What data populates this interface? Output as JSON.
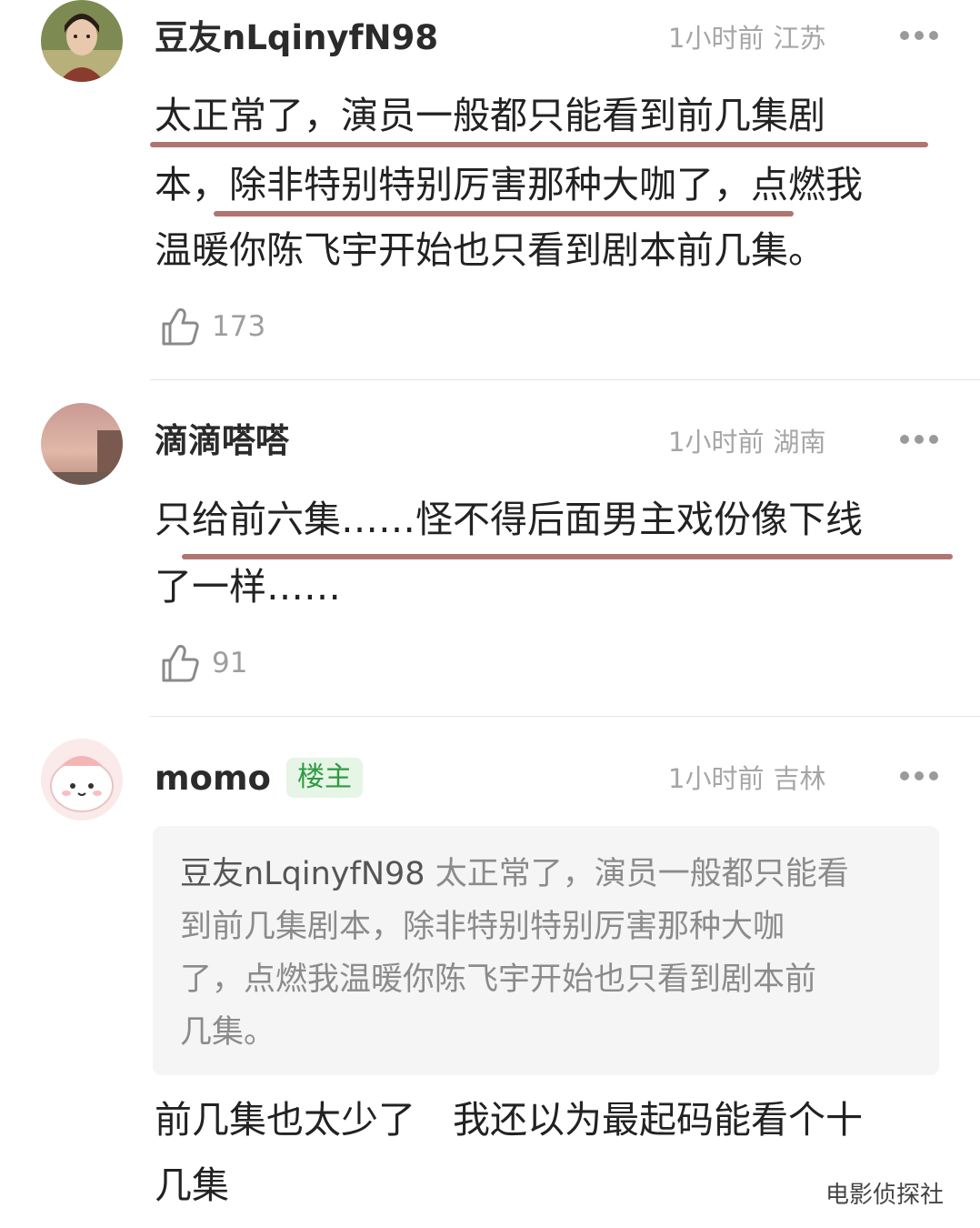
{
  "comments": [
    {
      "username": "豆友nLqinyfN98",
      "time": "1小时前",
      "location": "江苏",
      "lines": [
        "太正常了，演员一般都只能看到前几集剧",
        "本，除非特别特别厉害那种大咖了，点燃我",
        "温暖你陈飞宇开始也只看到剧本前几集。"
      ],
      "likes": "173",
      "avatar_icon": "portrait-avatar-icon"
    },
    {
      "username": "滴滴嗒嗒",
      "time": "1小时前",
      "location": "湖南",
      "lines": [
        "只给前六集……怪不得后面男主戏份像下线",
        "了一样……"
      ],
      "likes": "91",
      "avatar_icon": "sunset-avatar-icon"
    },
    {
      "username": "momo",
      "badge": "楼主",
      "time": "1小时前",
      "location": "吉林",
      "quote": {
        "author": "豆友nLqinyfN98",
        "line1": "太正常了，演员一般都只能看",
        "line2": "到前几集剧本，除非特别特别厉害那种大咖",
        "line3": "了，点燃我温暖你陈飞宇开始也只看到剧本前",
        "line4": "几集。"
      },
      "lines": [
        "前几集也太少了　我还以为最起码能看个十",
        "几集"
      ],
      "avatar_icon": "cartoon-avatar-icon"
    }
  ],
  "watermark": "电影侦探社",
  "colors": {
    "underline": "#b07471",
    "badge_bg": "#e6f5e6",
    "badge_text": "#2f9a43",
    "meta": "#a6a6a6"
  }
}
